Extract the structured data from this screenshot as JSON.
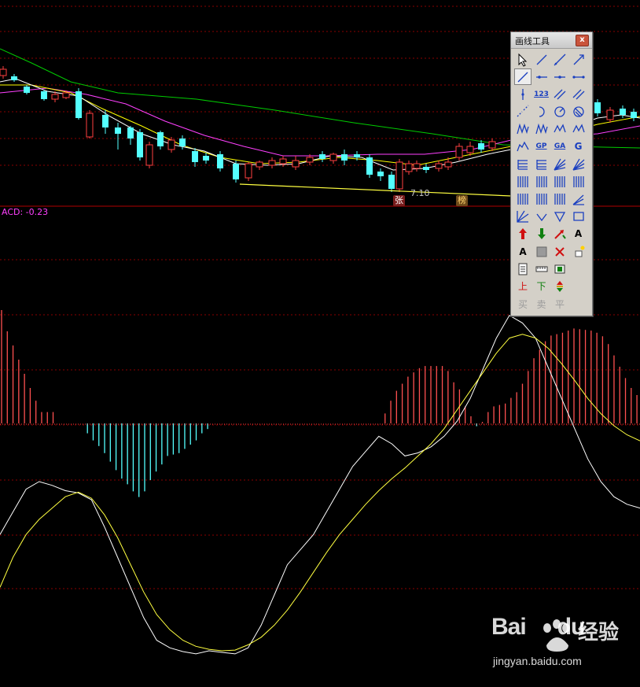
{
  "indicator": {
    "macd_label": "ACD: -0.23"
  },
  "annotations": {
    "price_note": "7.10",
    "badge_zhang": "张",
    "badge_bang": "榜"
  },
  "palette": {
    "title": "画线工具",
    "close": "x",
    "tools": [
      {
        "name": "cursor-arrow-icon",
        "type": "icon",
        "icon": "arrow"
      },
      {
        "name": "line-segment-icon",
        "type": "icon",
        "icon": "line"
      },
      {
        "name": "ray-line-icon",
        "type": "icon",
        "icon": "line2"
      },
      {
        "name": "arrow-line-icon",
        "type": "icon",
        "icon": "arrowline"
      },
      {
        "name": "straight-line-icon",
        "type": "icon",
        "icon": "line",
        "selected": true
      },
      {
        "name": "horizontal-point-icon",
        "type": "icon",
        "icon": "hdot"
      },
      {
        "name": "horizontal-ray-icon",
        "type": "icon",
        "icon": "hray"
      },
      {
        "name": "horizontal-segment-icon",
        "type": "icon",
        "icon": "hseg"
      },
      {
        "name": "vertical-line-icon",
        "type": "icon",
        "icon": "vline"
      },
      {
        "name": "price-label-icon",
        "type": "text",
        "text": "123"
      },
      {
        "name": "parallel-lines-icon",
        "type": "icon",
        "icon": "parallel"
      },
      {
        "name": "parallel-channel-icon",
        "type": "icon",
        "icon": "parallel"
      },
      {
        "name": "dotted-lines-icon",
        "type": "icon",
        "icon": "dashes"
      },
      {
        "name": "circle-arc-icon",
        "type": "icon",
        "icon": "arc"
      },
      {
        "name": "circle-icon",
        "type": "icon",
        "icon": "circle"
      },
      {
        "name": "circle-cross-icon",
        "type": "icon",
        "icon": "circlex"
      },
      {
        "name": "wave-w-icon",
        "type": "icon",
        "icon": "wave"
      },
      {
        "name": "wave-m-icon",
        "type": "icon",
        "icon": "wave"
      },
      {
        "name": "wave-n-icon",
        "type": "icon",
        "icon": "wave2"
      },
      {
        "name": "wave-v-icon",
        "type": "icon",
        "icon": "wave2"
      },
      {
        "name": "mountain-wave-icon",
        "type": "icon",
        "icon": "mountain"
      },
      {
        "name": "gann-gp-icon",
        "type": "text",
        "text": "GP"
      },
      {
        "name": "gann-ga-icon",
        "type": "text",
        "text": "GA"
      },
      {
        "name": "gann-g-icon",
        "type": "text",
        "text": "G"
      },
      {
        "name": "fibonacci-level-icon",
        "type": "icon",
        "icon": "levels"
      },
      {
        "name": "fibonacci-t-icon",
        "type": "icon",
        "icon": "levels"
      },
      {
        "name": "speed-lines-icon",
        "type": "icon",
        "icon": "fan"
      },
      {
        "name": "fan-lines-icon",
        "type": "icon",
        "icon": "fan"
      },
      {
        "name": "time-zone-icon",
        "type": "icon",
        "icon": "vbars"
      },
      {
        "name": "cycle-lines-icon",
        "type": "icon",
        "icon": "vbars"
      },
      {
        "name": "fibonacci-time-icon",
        "type": "icon",
        "icon": "vbars"
      },
      {
        "name": "gann-9-icon",
        "type": "icon",
        "icon": "vbars"
      },
      {
        "name": "multi-vertical-icon",
        "type": "icon",
        "icon": "vbars"
      },
      {
        "name": "equal-time-icon",
        "type": "icon",
        "icon": "vbars"
      },
      {
        "name": "time-ratio-icon",
        "type": "icon",
        "icon": "vbars"
      },
      {
        "name": "angle-lines-icon",
        "type": "icon",
        "icon": "angle"
      },
      {
        "name": "gann-fan-icon",
        "type": "icon",
        "icon": "fan2"
      },
      {
        "name": "down-arrow-line-icon",
        "type": "icon",
        "icon": "vee"
      },
      {
        "name": "triangle-icon",
        "type": "icon",
        "icon": "triangle"
      },
      {
        "name": "rectangle-icon",
        "type": "icon",
        "icon": "rect"
      },
      {
        "name": "up-arrow-icon",
        "type": "icon",
        "icon": "uparrow"
      },
      {
        "name": "down-arrow-icon",
        "type": "icon",
        "icon": "downarrow"
      },
      {
        "name": "trend-arrow-icon",
        "type": "icon",
        "icon": "trendarrow"
      },
      {
        "name": "text-icon",
        "type": "text",
        "text": "A"
      },
      {
        "name": "text-note-icon",
        "type": "text",
        "text": "A"
      },
      {
        "name": "grey-box-icon",
        "type": "icon",
        "icon": "greybox"
      },
      {
        "name": "delete-icon",
        "type": "icon",
        "icon": "cross"
      },
      {
        "name": "lock-icon",
        "type": "icon",
        "icon": "lock"
      },
      {
        "name": "document-icon",
        "type": "icon",
        "icon": "doc"
      },
      {
        "name": "ruler-icon",
        "type": "icon",
        "icon": "ruler"
      },
      {
        "name": "dollar-note-icon",
        "type": "icon",
        "icon": "money"
      },
      {
        "name": "empty-slot",
        "type": "empty"
      },
      {
        "name": "up-mark-icon",
        "type": "cn",
        "text": "上",
        "color": "#d01010"
      },
      {
        "name": "down-mark-icon",
        "type": "cn",
        "text": "下",
        "color": "#108010"
      },
      {
        "name": "up-down-arrows-icon",
        "type": "icon",
        "icon": "updown"
      },
      {
        "name": "empty-slot",
        "type": "empty"
      },
      {
        "name": "buy-button",
        "type": "cn",
        "text": "买",
        "disabled": true
      },
      {
        "name": "sell-button",
        "type": "cn",
        "text": "卖",
        "disabled": true
      },
      {
        "name": "flat-button",
        "type": "cn",
        "text": "平",
        "disabled": true
      },
      {
        "name": "empty-slot",
        "type": "empty"
      }
    ]
  },
  "watermark": {
    "logo": "Bai",
    "logo2": "du",
    "cn": "经验",
    "url": "jingyan.baidu.com"
  },
  "colors": {
    "up": "#ff4040",
    "down": "#54ffff",
    "ma5": "#ffffff",
    "ma10": "#ffff00",
    "ma20": "#ff40ff",
    "ma60": "#00cc00",
    "grid": "#8a0000",
    "divider": "#a00000"
  },
  "chart_data": {
    "type": "candlestick+macd",
    "macd_hist": [
      16,
      13,
      11,
      9,
      7,
      5,
      3.2,
      1.6,
      1.6,
      1.6,
      0,
      0,
      0,
      0,
      0,
      -1.4,
      -2.4,
      -3.2,
      -4.2,
      -5.4,
      -6.6,
      -7.8,
      -8.6,
      -9.6,
      -10.4,
      -9.6,
      -8,
      -6.8,
      -5.8,
      -4.6,
      -4.4,
      -4.2,
      -3.6,
      -3,
      -2.4,
      -1.4,
      -0.8,
      0,
      0,
      0,
      0,
      0,
      0,
      0,
      0,
      0,
      0,
      0,
      0,
      0,
      0,
      0,
      0,
      0,
      0,
      0,
      0,
      0,
      0,
      0,
      0,
      0,
      0,
      0,
      0,
      0,
      0,
      1.4,
      3.2,
      4.6,
      5.6,
      6.6,
      7.2,
      7.8,
      8.1,
      8.1,
      8.1,
      8.1,
      7.4,
      5.8,
      4.8,
      2.4,
      1.0,
      -0.4,
      0.2,
      1.6,
      2.4,
      2.6,
      2.8,
      3.6,
      4.4,
      5.6,
      7.4,
      9.2,
      10.4,
      11.6,
      12.4,
      12.6,
      12.8,
      13.1,
      13.4,
      13.3,
      13.2,
      13.1,
      12.8,
      12.3,
      11.2,
      9.6,
      8,
      6.4,
      5,
      4
    ],
    "dif_line": [
      -2,
      1,
      4,
      5,
      4.5,
      3.8,
      3.5,
      2.6,
      -1,
      -5,
      -9,
      -13,
      -16,
      -17,
      -17.5,
      -17.8,
      -17.4,
      -17.6,
      -17.8,
      -17,
      -14,
      -10,
      -6,
      -4,
      -2,
      1,
      4,
      7,
      9,
      11,
      10,
      8.4,
      8.8,
      9.6,
      11,
      13,
      16,
      20,
      24,
      27,
      26,
      24,
      20,
      16,
      12,
      8,
      5,
      3,
      2,
      1.5
    ],
    "dea_line": [
      -9,
      -5,
      -2,
      0,
      1.5,
      3,
      3.6,
      2.8,
      0.6,
      -2.4,
      -6,
      -9.6,
      -12.6,
      -14.6,
      -16,
      -16.8,
      -17.2,
      -17.4,
      -17.3,
      -16.6,
      -15.6,
      -14,
      -12,
      -9.6,
      -7,
      -4.4,
      -2,
      0,
      2,
      3.8,
      5.4,
      6.8,
      8.4,
      10,
      12,
      14.5,
      17,
      19.5,
      22,
      24,
      24.5,
      24,
      22.6,
      20.6,
      18.4,
      16,
      14,
      12.4,
      11.2,
      10.4
    ]
  }
}
